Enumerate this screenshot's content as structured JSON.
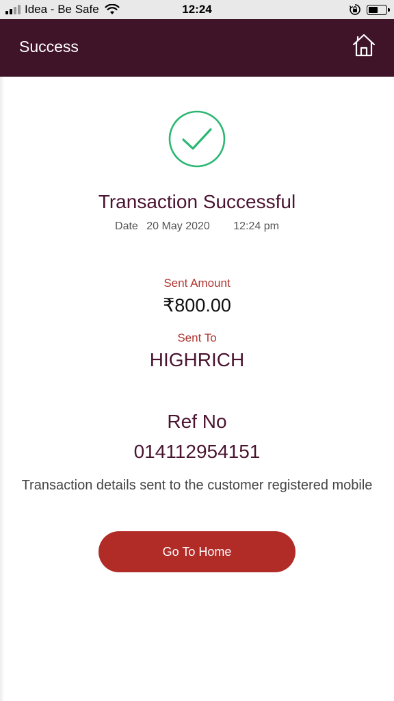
{
  "status_bar": {
    "carrier": "Idea - Be Safe",
    "time": "12:24",
    "battery_level": 0.55,
    "icons": [
      "signal-icon",
      "wifi-icon",
      "rotation-lock-icon",
      "battery-icon"
    ]
  },
  "header": {
    "title": "Success",
    "background": "#3f1328",
    "home_icon": "home-icon"
  },
  "result": {
    "icon": "check-circle-icon",
    "icon_color": "#2bb673",
    "title": "Transaction Successful",
    "date_label": "Date",
    "date_value": "20 May 2020",
    "time_value": "12:24 pm"
  },
  "details": {
    "sent_amount_label": "Sent Amount",
    "sent_amount_value": "₹800.00",
    "sent_to_label": "Sent To",
    "sent_to_value": "HIGHRICH",
    "ref_label": "Ref No",
    "ref_value": "014112954151",
    "note": "Transaction details sent to the customer registered mobile"
  },
  "actions": {
    "go_home_label": "Go To Home",
    "button_color": "#b12b27"
  }
}
